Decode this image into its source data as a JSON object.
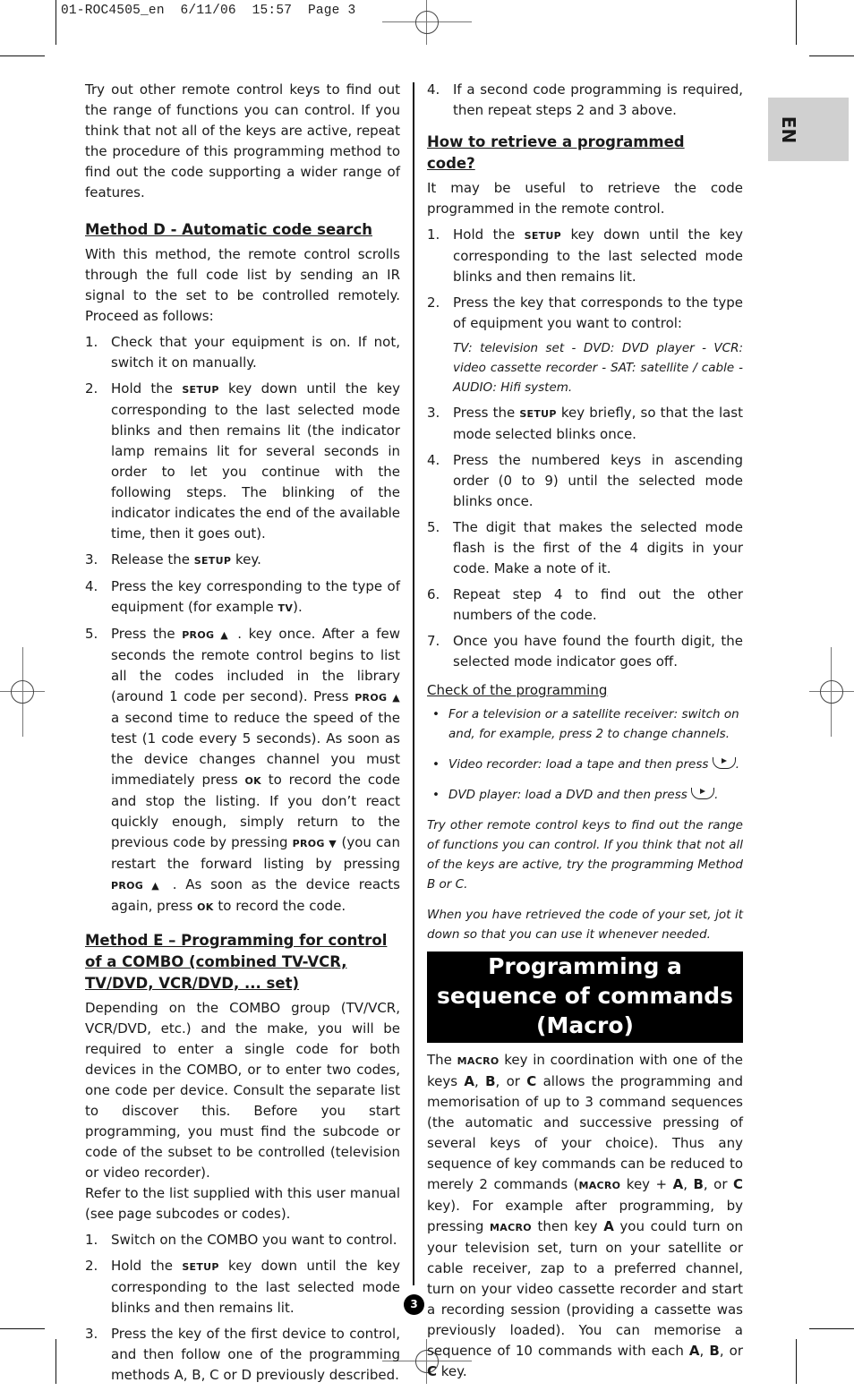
{
  "slug": "01-ROC4505_en  6/11/06  15:57  Page 3",
  "language_tab": "EN",
  "page_number": "3",
  "left": {
    "intro": "Try out other remote control keys to find out the range of functions you can control. If you think that not all of the keys are active, repeat the procedure of this programming method to find out the code supporting a wider range of features.",
    "method_d": {
      "heading": "Method D - Automatic code search",
      "intro": "With this method, the remote control scrolls through the full code list by sending an IR signal to the set to be controlled remotely. Proceed as follows:",
      "steps": [
        {
          "n": "1.",
          "text": "Check that your equipment is on. If not, switch it on manually."
        },
        {
          "n": "2.",
          "pre": "Hold the ",
          "key": "SETUP",
          "post": " key down until the key corresponding to the last selected mode blinks and then remains lit (the indicator lamp remains lit for several seconds in order to let you continue with the following steps. The blinking of the indicator indicates the end of the available time, then it goes out)."
        },
        {
          "n": "3.",
          "pre": "Release the ",
          "key": "SETUP",
          "post": " key."
        },
        {
          "n": "4.",
          "pre": "Press the key corresponding to the type of equipment (for example ",
          "key": "TV",
          "post": ")."
        },
        {
          "n": "5.",
          "parts": [
            "Press the ",
            "PROG ▲",
            " . key once. After a few seconds the remote control begins to list all the codes included in the library (around 1 code per second). Press ",
            "PROG ▲",
            "  a second time to reduce the speed of the test (1 code every 5 seconds). As soon as the device changes channel you must immediately press ",
            "OK",
            " to record the code and stop the listing. If you don’t react quickly enough, simply return to the previous code by pressing ",
            "PROG ▼",
            "  (you can restart the forward listing by pressing ",
            "PROG ▲",
            " . As soon as the device reacts again, press ",
            "OK",
            " to record the code."
          ]
        }
      ]
    },
    "method_e": {
      "heading": "Method E – Programming for control of a COMBO (combined TV-VCR, TV/DVD, VCR/DVD, ... set)",
      "intro1": "Depending on the COMBO group (TV/VCR, VCR/DVD, etc.) and the make, you will be required to enter a single code for both devices in the COMBO, or to enter two codes, one code per device. Consult the separate list to discover this. Before you start programming, you must find the subcode or code of the subset to be controlled (television or video recorder).",
      "intro2": "Refer to the list supplied with this user manual (see page subcodes or codes).",
      "steps": [
        {
          "n": "1.",
          "text": "Switch on the COMBO you want to control."
        },
        {
          "n": "2.",
          "pre": "Hold the ",
          "key": "SETUP",
          "post": " key down until the key corresponding to the last selected mode blinks and then remains lit."
        },
        {
          "n": "3.",
          "text": "Press the key of the first device to control, and then follow one of the programming methods A, B, C or D previously described."
        }
      ]
    }
  },
  "right": {
    "step4": {
      "n": "4.",
      "text": "If a second code programming is required, then repeat steps 2 and 3 above."
    },
    "retrieve": {
      "heading": "How to retrieve a programmed code?",
      "intro": "It may be useful to retrieve the code programmed in the remote control.",
      "steps": [
        {
          "n": "1.",
          "pre": "Hold the ",
          "key": "SETUP",
          "post": " key down until the key corresponding to the last selected mode blinks and then remains lit."
        },
        {
          "n": "2.",
          "text": "Press the key that corresponds to the type of equipment you want to control:",
          "note": "TV: television set - DVD: DVD player - VCR: video cassette recorder - SAT: satellite / cable - AUDIO: Hifi system."
        },
        {
          "n": "3.",
          "pre": "Press the ",
          "key": "SETUP",
          "post": " key briefly, so that the last mode selected blinks once."
        },
        {
          "n": "4.",
          "text": "Press the numbered keys in ascending order (0 to 9) until the selected mode blinks once."
        },
        {
          "n": "5.",
          "text": "The digit that makes the selected mode flash is the first of the 4 digits in your code. Make a note of it."
        },
        {
          "n": "6.",
          "text": "Repeat step 4 to find out the other numbers of the code."
        },
        {
          "n": "7.",
          "text": "Once you have found the fourth digit, the selected mode indicator goes off."
        }
      ]
    },
    "check": {
      "heading": "Check of the programming",
      "bullets": [
        {
          "text": "For a television or a satellite receiver: switch on and, for example, press 2 to change channels."
        },
        {
          "text": "Video recorder: load a tape and then press ",
          "icon": "play-key-icon"
        },
        {
          "text": "DVD player: load a DVD and then press ",
          "icon": "play-key-icon"
        }
      ],
      "note1": "Try other remote control keys to find out the range of functions you can control. If you think that not all of the keys are active, try the programming Method B or C.",
      "note2": "When you have retrieved the code of your set, jot it down so that you can use it whenever needed."
    },
    "macro": {
      "banner": "Programming a sequence of commands (Macro)",
      "parts": [
        "The ",
        "MACRO",
        " key in coordination with one of the keys ",
        "A",
        ", ",
        "B",
        ", or ",
        "C",
        " allows the programming and memorisation of up to 3 command sequences (the automatic and successive pressing of several keys of your choice). Thus any sequence of key commands can be reduced to merely 2 commands (",
        "MACRO",
        " key + ",
        "A",
        ", ",
        "B",
        ", or ",
        "C",
        " key). For example after programming, by pressing ",
        "MACRO",
        " then key ",
        "A",
        " you could turn on your television set, turn on your satellite or cable receiver, zap to a preferred channel, turn on your video cassette recorder and start a recording session (providing a cassette was previously loaded). You can memorise a sequence of 10 commands with each ",
        "A",
        ", ",
        "B",
        ", or ",
        "C",
        " key."
      ]
    }
  }
}
